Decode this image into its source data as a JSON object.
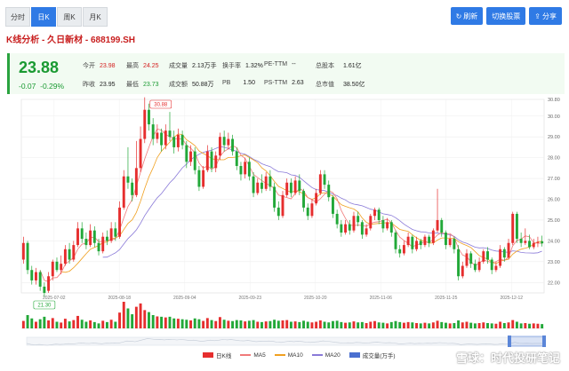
{
  "tabs": [
    {
      "label": "分时",
      "active": false
    },
    {
      "label": "日K",
      "active": true
    },
    {
      "label": "周K",
      "active": false
    },
    {
      "label": "月K",
      "active": false
    }
  ],
  "toolbar": {
    "refresh": "刷新",
    "switch": "切换股票",
    "share": "分享"
  },
  "stock": {
    "title": "K线分析 - 久日新材 - 688199.SH"
  },
  "quote": {
    "price": "23.88",
    "change": "-0.07",
    "change_pct": "-0.29%",
    "open_label": "今开",
    "open": "23.98",
    "prev_label": "昨收",
    "prev": "23.95",
    "high_label": "最高",
    "high": "24.25",
    "low_label": "最低",
    "low": "23.73",
    "vol_label": "成交量",
    "vol": "2.13万手",
    "amt_label": "成交额",
    "amt": "50.88万",
    "turnover_label": "换手率",
    "turnover": "1.32%",
    "pb_label": "PB",
    "pb": "1.50",
    "pe_label": "PE-TTM",
    "pe": "--",
    "ps_label": "PS-TTM",
    "ps": "2.63",
    "shares_label": "总股本",
    "shares": "1.61亿",
    "mcap_label": "总市值",
    "mcap": "38.50亿"
  },
  "chart_data": {
    "type": "candlestick",
    "ylim": [
      21.5,
      30.8
    ],
    "yticks": [
      22.0,
      23.0,
      24.0,
      25.0,
      26.0,
      27.0,
      28.0,
      29.0,
      30.0,
      30.8
    ],
    "xticks": [
      "2025-07-02",
      "2025-08-18",
      "2025-09-04",
      "2025-09-23",
      "2025-10-20",
      "2025-11-06",
      "2025-11-25",
      "2025-12-12"
    ],
    "max_label": "30.88",
    "min_label": "21.30",
    "colors": {
      "up": "#e62e2e",
      "down": "#22a838",
      "ma5": "#f07a7a",
      "ma10": "#f0a020",
      "ma20": "#8a7ad8"
    },
    "candles": [
      [
        23.1,
        23.9,
        24.2,
        22.9
      ],
      [
        23.9,
        22.6,
        24.0,
        22.4
      ],
      [
        22.6,
        22.1,
        22.8,
        21.9
      ],
      [
        22.1,
        22.5,
        22.7,
        21.9
      ],
      [
        22.5,
        21.8,
        22.6,
        21.6
      ],
      [
        21.8,
        21.5,
        22.0,
        21.3
      ],
      [
        21.6,
        22.3,
        22.5,
        21.5
      ],
      [
        22.3,
        23.0,
        23.1,
        22.1
      ],
      [
        23.0,
        22.6,
        23.2,
        22.5
      ],
      [
        22.6,
        22.9,
        23.3,
        22.4
      ],
      [
        22.9,
        23.6,
        23.8,
        22.8
      ],
      [
        23.6,
        23.1,
        23.9,
        22.9
      ],
      [
        23.1,
        23.8,
        24.0,
        23.0
      ],
      [
        23.8,
        24.6,
        24.9,
        23.7
      ],
      [
        24.6,
        24.1,
        24.9,
        23.9
      ],
      [
        24.1,
        23.8,
        24.4,
        23.6
      ],
      [
        23.8,
        24.5,
        24.8,
        23.7
      ],
      [
        24.5,
        23.9,
        24.7,
        23.7
      ],
      [
        23.9,
        23.5,
        24.1,
        23.3
      ],
      [
        23.5,
        24.2,
        24.4,
        23.4
      ],
      [
        24.2,
        24.0,
        24.5,
        23.8
      ],
      [
        24.0,
        24.6,
        24.9,
        23.9
      ],
      [
        24.6,
        24.2,
        24.9,
        24.0
      ],
      [
        24.2,
        25.6,
        25.9,
        24.1
      ],
      [
        25.6,
        27.1,
        27.4,
        25.5
      ],
      [
        27.1,
        26.8,
        28.5,
        26.5
      ],
      [
        26.8,
        26.2,
        27.0,
        25.9
      ],
      [
        26.2,
        27.5,
        28.8,
        26.1
      ],
      [
        27.5,
        28.9,
        29.5,
        27.3
      ],
      [
        28.9,
        30.3,
        30.9,
        28.7
      ],
      [
        30.3,
        29.6,
        30.6,
        29.3
      ],
      [
        29.6,
        28.9,
        29.9,
        28.6
      ],
      [
        28.9,
        29.2,
        29.6,
        28.7
      ],
      [
        29.2,
        28.6,
        29.4,
        28.3
      ],
      [
        28.6,
        29.3,
        29.6,
        28.4
      ],
      [
        29.3,
        29.0,
        30.2,
        28.8
      ],
      [
        29.0,
        28.5,
        29.3,
        28.2
      ],
      [
        28.5,
        29.1,
        29.4,
        28.3
      ],
      [
        29.1,
        28.6,
        29.3,
        28.4
      ],
      [
        28.6,
        27.8,
        28.8,
        27.5
      ],
      [
        27.8,
        28.3,
        28.6,
        27.6
      ],
      [
        28.3,
        27.4,
        28.5,
        27.2
      ],
      [
        27.4,
        26.6,
        27.6,
        26.4
      ],
      [
        26.6,
        27.4,
        27.6,
        26.5
      ],
      [
        27.4,
        28.3,
        28.6,
        27.3
      ],
      [
        28.3,
        27.5,
        28.5,
        27.3
      ],
      [
        27.5,
        28.1,
        28.3,
        27.3
      ],
      [
        28.1,
        29.0,
        29.2,
        27.9
      ],
      [
        29.0,
        28.6,
        29.3,
        28.3
      ],
      [
        28.6,
        28.9,
        29.2,
        28.4
      ],
      [
        28.9,
        28.3,
        29.1,
        28.1
      ],
      [
        28.3,
        27.6,
        28.5,
        27.4
      ],
      [
        27.6,
        27.2,
        27.8,
        26.9
      ],
      [
        27.2,
        27.8,
        28.0,
        27.0
      ],
      [
        27.8,
        27.1,
        28.0,
        26.9
      ],
      [
        27.1,
        26.3,
        27.3,
        26.1
      ],
      [
        26.3,
        26.8,
        27.0,
        26.2
      ],
      [
        26.8,
        26.5,
        27.2,
        26.3
      ],
      [
        26.5,
        27.1,
        27.3,
        26.4
      ],
      [
        27.1,
        26.6,
        27.4,
        26.4
      ],
      [
        26.6,
        25.6,
        26.8,
        25.4
      ],
      [
        25.6,
        25.2,
        25.9,
        25.0
      ],
      [
        25.2,
        26.2,
        26.4,
        25.1
      ],
      [
        26.2,
        26.8,
        27.0,
        26.1
      ],
      [
        26.8,
        26.3,
        27.0,
        26.1
      ],
      [
        26.3,
        26.9,
        27.1,
        26.2
      ],
      [
        26.9,
        26.4,
        27.2,
        26.2
      ],
      [
        26.4,
        25.6,
        26.5,
        25.4
      ],
      [
        25.6,
        25.2,
        25.8,
        25.0
      ],
      [
        25.2,
        25.8,
        26.0,
        25.1
      ],
      [
        25.8,
        26.3,
        26.5,
        25.7
      ],
      [
        26.3,
        27.2,
        27.4,
        26.2
      ],
      [
        27.2,
        26.7,
        27.4,
        26.5
      ],
      [
        26.7,
        26.1,
        26.9,
        25.9
      ],
      [
        26.1,
        25.3,
        26.2,
        25.1
      ],
      [
        25.3,
        24.8,
        25.5,
        24.6
      ],
      [
        24.8,
        24.4,
        25.0,
        24.2
      ],
      [
        24.4,
        24.8,
        25.0,
        24.3
      ],
      [
        24.8,
        24.5,
        25.0,
        24.3
      ],
      [
        24.5,
        25.2,
        25.4,
        24.4
      ],
      [
        25.2,
        24.9,
        25.4,
        24.7
      ],
      [
        24.9,
        24.3,
        25.0,
        24.1
      ],
      [
        24.3,
        24.6,
        24.8,
        24.2
      ],
      [
        24.6,
        25.2,
        25.3,
        24.5
      ],
      [
        25.2,
        25.5,
        25.6,
        25.0
      ],
      [
        25.5,
        25.0,
        25.6,
        24.8
      ],
      [
        25.0,
        24.6,
        25.2,
        24.4
      ],
      [
        24.6,
        24.9,
        25.1,
        24.5
      ],
      [
        24.9,
        24.4,
        25.0,
        24.2
      ],
      [
        24.4,
        23.6,
        24.5,
        23.4
      ],
      [
        23.6,
        23.4,
        23.8,
        23.2
      ],
      [
        23.4,
        23.8,
        24.0,
        23.3
      ],
      [
        23.8,
        24.2,
        24.4,
        23.7
      ],
      [
        24.2,
        23.6,
        24.3,
        23.4
      ],
      [
        23.6,
        24.0,
        24.2,
        23.5
      ],
      [
        24.0,
        23.8,
        24.1,
        23.6
      ],
      [
        23.8,
        24.2,
        24.3,
        23.7
      ],
      [
        24.2,
        23.9,
        24.3,
        23.7
      ],
      [
        23.9,
        24.5,
        24.6,
        23.8
      ],
      [
        24.5,
        25.0,
        26.5,
        24.4
      ],
      [
        25.0,
        24.4,
        25.1,
        24.2
      ],
      [
        24.4,
        23.8,
        24.5,
        23.6
      ],
      [
        23.8,
        24.1,
        24.3,
        23.7
      ],
      [
        24.1,
        23.6,
        24.2,
        23.4
      ],
      [
        23.6,
        22.3,
        23.8,
        22.1
      ],
      [
        22.3,
        22.8,
        23.0,
        22.2
      ],
      [
        22.8,
        23.4,
        23.6,
        22.7
      ],
      [
        23.4,
        22.9,
        23.5,
        22.7
      ],
      [
        22.9,
        22.6,
        23.1,
        22.5
      ],
      [
        22.6,
        23.0,
        23.2,
        22.5
      ],
      [
        23.0,
        23.5,
        23.6,
        22.9
      ],
      [
        23.5,
        23.1,
        23.7,
        22.9
      ],
      [
        23.1,
        22.6,
        23.2,
        22.4
      ],
      [
        22.6,
        22.8,
        23.0,
        22.5
      ],
      [
        22.8,
        23.6,
        23.8,
        22.7
      ],
      [
        23.6,
        23.2,
        23.7,
        23.0
      ],
      [
        23.2,
        23.9,
        24.1,
        23.1
      ],
      [
        23.9,
        25.3,
        25.4,
        23.8
      ],
      [
        25.3,
        24.1,
        25.4,
        23.9
      ],
      [
        24.1,
        23.9,
        24.4,
        23.7
      ],
      [
        23.9,
        24.0,
        24.6,
        23.8
      ],
      [
        24.0,
        23.7,
        24.3,
        23.6
      ],
      [
        23.7,
        23.9,
        24.1,
        23.6
      ],
      [
        23.9,
        23.95,
        24.2,
        23.7
      ],
      [
        23.98,
        23.88,
        24.25,
        23.73
      ]
    ],
    "volume": [
      45,
      80,
      60,
      40,
      55,
      70,
      48,
      62,
      40,
      35,
      58,
      42,
      50,
      75,
      52,
      40,
      48,
      38,
      30,
      46,
      38,
      52,
      40,
      95,
      160,
      120,
      85,
      130,
      150,
      110,
      98,
      80,
      72,
      70,
      66,
      70,
      60,
      58,
      55,
      52,
      48,
      60,
      55,
      45,
      62,
      50,
      44,
      68,
      52,
      46,
      44,
      50,
      48,
      42,
      46,
      50,
      40,
      38,
      42,
      44,
      52,
      46,
      48,
      50,
      40,
      42,
      38,
      46,
      40,
      36,
      40,
      48,
      40,
      36,
      44,
      46,
      38,
      34,
      36,
      42,
      36,
      38,
      32,
      40,
      44,
      36,
      34,
      30,
      38,
      44,
      38,
      34,
      38,
      36,
      32,
      30,
      34,
      30,
      36,
      46,
      38,
      34,
      30,
      32,
      48,
      36,
      40,
      34,
      30,
      32,
      36,
      32,
      30,
      28,
      40,
      32,
      36,
      50,
      40,
      30,
      32,
      28,
      30,
      28,
      26
    ]
  },
  "legend": {
    "kline": "日K线",
    "ma5": "MA5",
    "ma10": "MA10",
    "ma20": "MA20",
    "vol": "成交量(万手)"
  },
  "watermark": "雪球：时代投研笔记"
}
